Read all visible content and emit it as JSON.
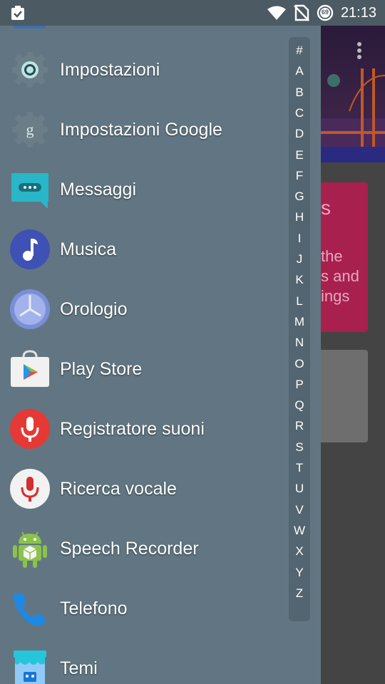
{
  "status_bar": {
    "time": "21:13",
    "notification_icon": "clipboard-check-icon",
    "wifi_icon": "wifi-icon",
    "no_signal_icon": "no-sim-icon",
    "battery_icon": "battery-icon",
    "battery_level": "69"
  },
  "drawer": {
    "apps": [
      {
        "label": "Impostazioni",
        "icon": "settings-gear-icon"
      },
      {
        "label": "Impostazioni Google",
        "icon": "google-settings-icon"
      },
      {
        "label": "Messaggi",
        "icon": "messages-icon"
      },
      {
        "label": "Musica",
        "icon": "music-icon"
      },
      {
        "label": "Orologio",
        "icon": "clock-icon"
      },
      {
        "label": "Play Store",
        "icon": "play-store-icon"
      },
      {
        "label": "Registratore suoni",
        "icon": "sound-recorder-icon"
      },
      {
        "label": "Ricerca vocale",
        "icon": "voice-search-icon"
      },
      {
        "label": "Speech Recorder",
        "icon": "android-icon"
      },
      {
        "label": "Telefono",
        "icon": "phone-icon"
      },
      {
        "label": "Temi",
        "icon": "themes-icon"
      }
    ],
    "alphabet": [
      "#",
      "A",
      "B",
      "C",
      "D",
      "E",
      "F",
      "G",
      "H",
      "I",
      "J",
      "K",
      "L",
      "M",
      "N",
      "O",
      "P",
      "Q",
      "R",
      "S",
      "T",
      "U",
      "V",
      "W",
      "X",
      "Y",
      "Z"
    ]
  },
  "background_app": {
    "card_text_lines": [
      "s",
      "the",
      "s and",
      "ings"
    ]
  },
  "colors": {
    "drawer_bg": "#617682",
    "status_bar_bg": "#4c5a63",
    "index_bg": "#536570",
    "card_red": "#a8204e"
  }
}
